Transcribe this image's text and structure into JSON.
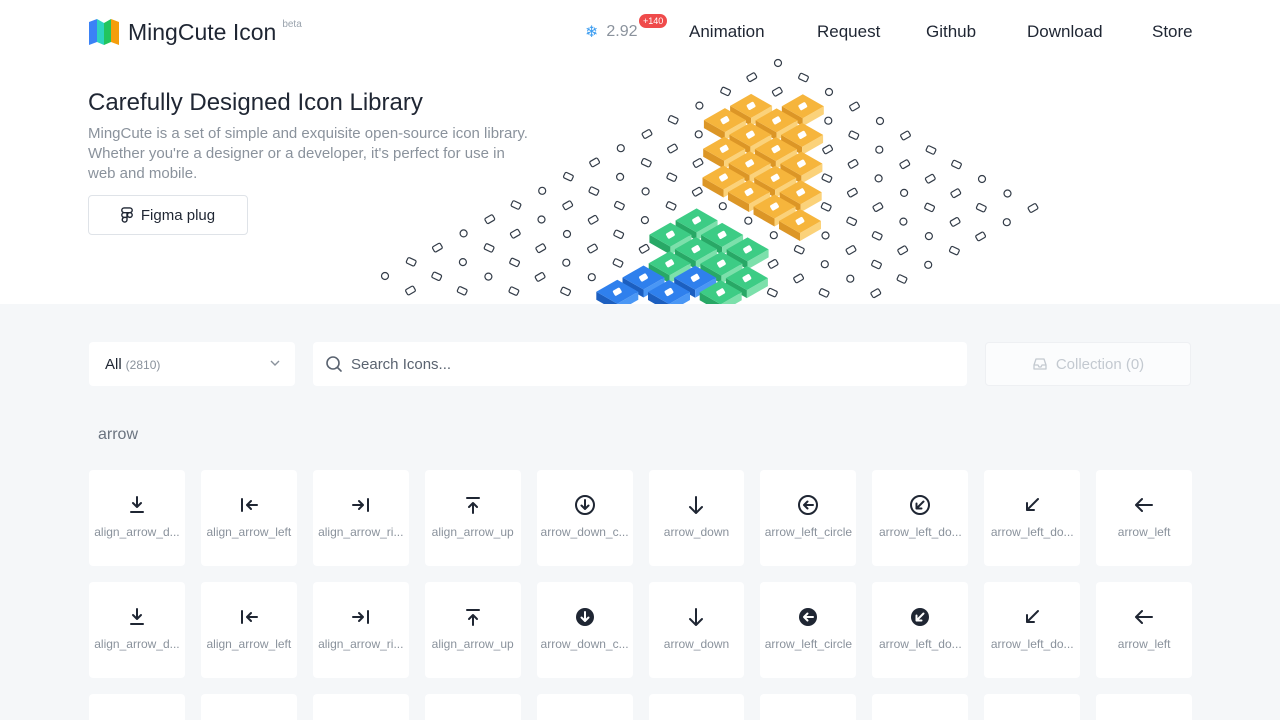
{
  "header": {
    "brand": "MingCute Icon",
    "beta": "beta",
    "version_icon": "snowflake-icon",
    "version": "2.92",
    "badge": "+140",
    "nav": [
      "Animation",
      "Request",
      "Github",
      "Download",
      "Store"
    ]
  },
  "hero": {
    "title": "Carefully Designed Icon Library",
    "description": "MingCute is a set of simple and exquisite open-source icon library. Whether you're a designer or a developer, it's perfect for use in web and mobile.",
    "figma_button": "Figma plug"
  },
  "toolbar": {
    "category": "All",
    "category_count": "(2810)",
    "search_placeholder": "Search Icons...",
    "collection": "Collection (0)"
  },
  "section": {
    "title": "arrow"
  },
  "rows": [
    {
      "style": "line",
      "items": [
        {
          "label": "align_arrow_d...",
          "icon": "align-arrow-down-icon"
        },
        {
          "label": "align_arrow_left",
          "icon": "align-arrow-left-icon"
        },
        {
          "label": "align_arrow_ri...",
          "icon": "align-arrow-right-icon"
        },
        {
          "label": "align_arrow_up",
          "icon": "align-arrow-up-icon"
        },
        {
          "label": "arrow_down_c...",
          "icon": "arrow-down-circle-icon"
        },
        {
          "label": "arrow_down",
          "icon": "arrow-down-icon"
        },
        {
          "label": "arrow_left_circle",
          "icon": "arrow-left-circle-icon"
        },
        {
          "label": "arrow_left_do...",
          "icon": "arrow-left-down-circle-icon"
        },
        {
          "label": "arrow_left_do...",
          "icon": "arrow-left-down-icon"
        },
        {
          "label": "arrow_left",
          "icon": "arrow-left-icon"
        }
      ]
    },
    {
      "style": "fill",
      "items": [
        {
          "label": "align_arrow_d...",
          "icon": "align-arrow-down-icon"
        },
        {
          "label": "align_arrow_left",
          "icon": "align-arrow-left-icon"
        },
        {
          "label": "align_arrow_ri...",
          "icon": "align-arrow-right-icon"
        },
        {
          "label": "align_arrow_up",
          "icon": "align-arrow-up-icon"
        },
        {
          "label": "arrow_down_c...",
          "icon": "arrow-down-circle-icon"
        },
        {
          "label": "arrow_down",
          "icon": "arrow-down-icon"
        },
        {
          "label": "arrow_left_circle",
          "icon": "arrow-left-circle-icon"
        },
        {
          "label": "arrow_left_do...",
          "icon": "arrow-left-down-circle-icon"
        },
        {
          "label": "arrow_left_do...",
          "icon": "arrow-left-down-icon"
        },
        {
          "label": "arrow_left",
          "icon": "arrow-left-icon"
        }
      ]
    }
  ],
  "colors": {
    "text": "#1f2633",
    "muted": "#8a929c",
    "badge": "#ef4b4b",
    "tile_blue": "#2f80ed",
    "tile_green": "#3dcc85",
    "tile_orange": "#f6b53c"
  }
}
